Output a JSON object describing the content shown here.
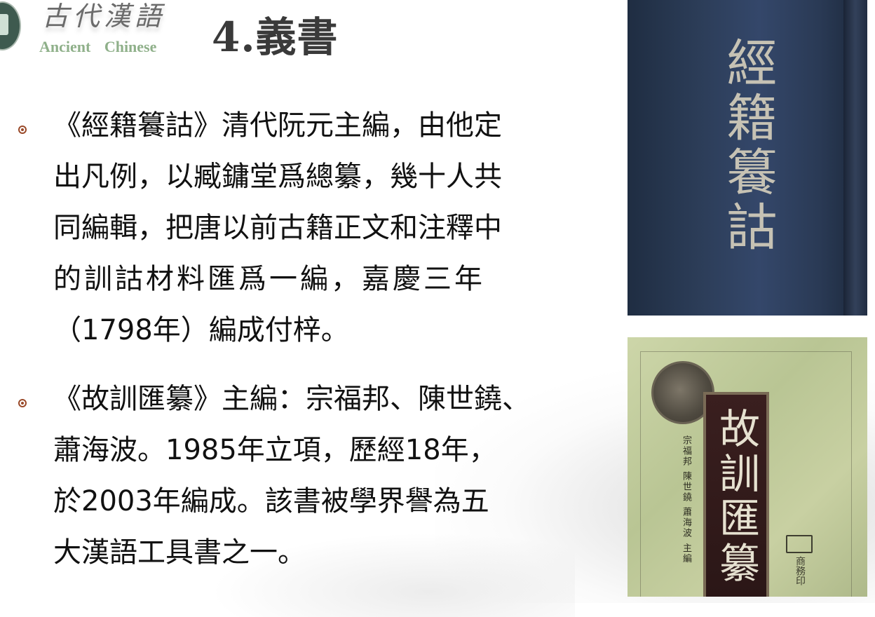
{
  "header": {
    "logo_cn": "古代漢語",
    "logo_en": "Ancient Chinese",
    "title": "4.義書"
  },
  "bullets": [
    {
      "lines": [
        "《經籍籑詁》清代阮元主編，由他定",
        "出凡例，以臧鏞堂爲總纂，幾十人共",
        "同編輯，把唐以前古籍正文和注釋中",
        "的訓詁材料匯爲一編，嘉慶三年",
        "（1798年）編成付梓。"
      ]
    },
    {
      "lines": [
        "《故訓匯纂》主編：宗福邦、陳世鐃、",
        "蕭海波。1985年立項，歷經18年，",
        "於2003年編成。該書被學界譽為五",
        "大漢語工具書之一。"
      ]
    }
  ],
  "images": {
    "book1_title": "經籍籑詁",
    "book2_title": "故訓匯纂",
    "book2_authors": "宗福邦 陳世鐃 蕭海波 主編",
    "book2_publisher": "商務印"
  },
  "colors": {
    "bullet": "#9a4a2a",
    "logo_en": "#8fb08a",
    "title": "#3a3a3a"
  }
}
